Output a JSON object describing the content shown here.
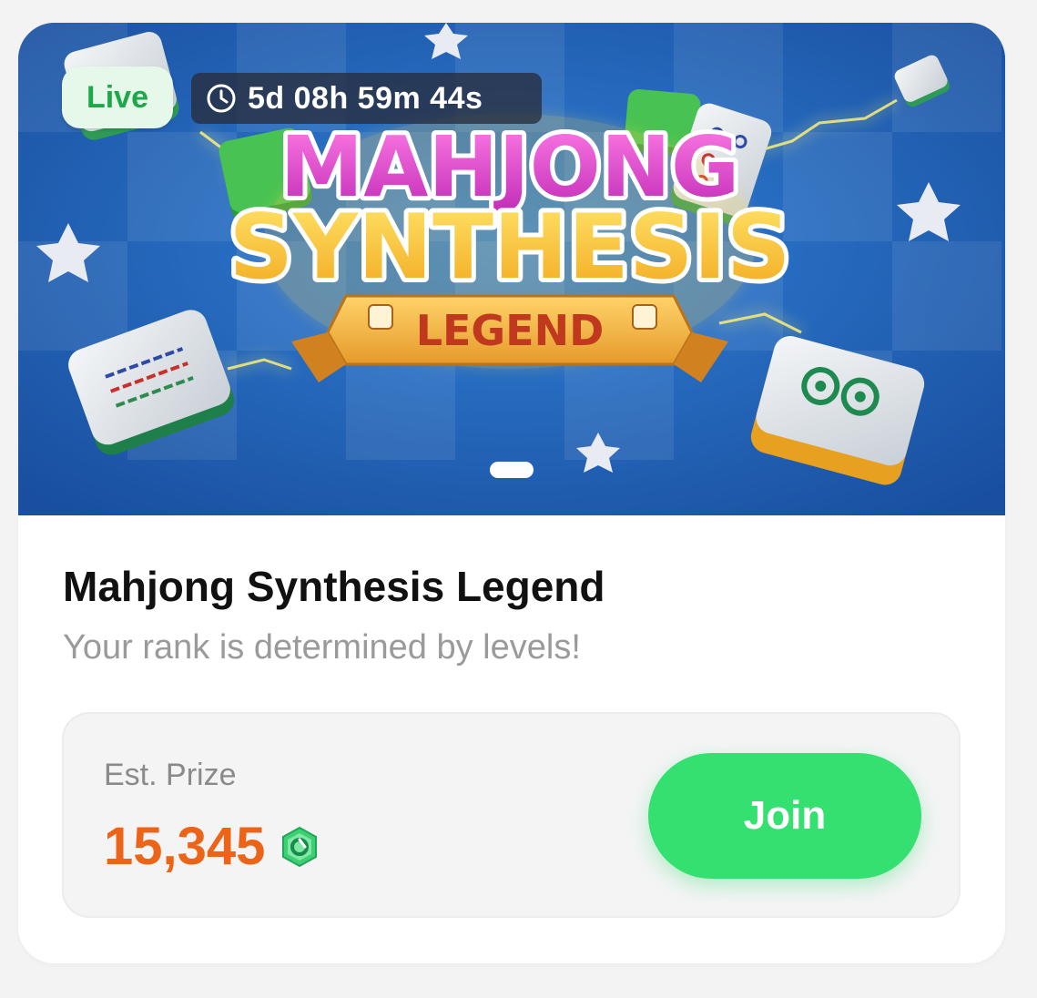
{
  "banner": {
    "live_label": "Live",
    "countdown": "5d 08h 59m 44s",
    "logo_line1": "MAHJONG",
    "logo_line2": "SYNTHESIS",
    "logo_line3": "LEGEND"
  },
  "event": {
    "title": "Mahjong Synthesis Legend",
    "subtitle": "Your rank is determined by levels!"
  },
  "prize": {
    "label": "Est. Prize",
    "value": "15,345",
    "currency_icon": "gem-coin-icon",
    "join_label": "Join"
  },
  "colors": {
    "live_text": "#1ea84a",
    "prize_value": "#ec6417",
    "join_button": "#34e06f",
    "banner_bg": "#1f5fb8"
  }
}
